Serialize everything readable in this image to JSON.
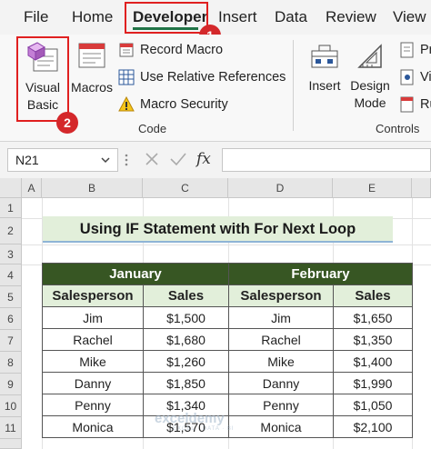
{
  "ribbon_tabs": [
    {
      "label": "File",
      "active": false
    },
    {
      "label": "Home",
      "active": false
    },
    {
      "label": "Developer",
      "active": true
    },
    {
      "label": "Insert",
      "active": false
    },
    {
      "label": "Data",
      "active": false
    },
    {
      "label": "Review",
      "active": false
    },
    {
      "label": "View",
      "active": false
    }
  ],
  "callouts": {
    "first": "1",
    "second": "2"
  },
  "code_group": {
    "visual_basic_line1": "Visual",
    "visual_basic_line2": "Basic",
    "macros": "Macros",
    "record_macro": "Record Macro",
    "use_relative_references": "Use Relative References",
    "macro_security": "Macro Security",
    "label": "Code"
  },
  "controls_group": {
    "insert": "Insert",
    "design_mode_line1": "Design",
    "design_mode_line2": "Mode",
    "properties": "Pr",
    "view_code": "Vi",
    "run_dialog": "Ru",
    "label": "Controls"
  },
  "formula_bar": {
    "name_box": "N21",
    "fx": "fx",
    "formula": ""
  },
  "columns": [
    "A",
    "B",
    "C",
    "D",
    "E"
  ],
  "rows": [
    "1",
    "2",
    "3",
    "4",
    "5",
    "6",
    "7",
    "8",
    "9",
    "10",
    "11"
  ],
  "sheet": {
    "title": "Using IF Statement with For Next Loop",
    "months": [
      "January",
      "February"
    ],
    "headers": [
      "Salesperson",
      "Sales",
      "Salesperson",
      "Sales"
    ],
    "records": [
      [
        "Jim",
        "$1,500",
        "Jim",
        "$1,650"
      ],
      [
        "Rachel",
        "$1,680",
        "Rachel",
        "$1,350"
      ],
      [
        "Mike",
        "$1,260",
        "Mike",
        "$1,400"
      ],
      [
        "Danny",
        "$1,850",
        "Danny",
        "$1,990"
      ],
      [
        "Penny",
        "$1,340",
        "Penny",
        "$1,050"
      ],
      [
        "Monica",
        "$1,570",
        "Monica",
        "$2,100"
      ]
    ]
  },
  "watermark": {
    "brand": "exceldemy",
    "tagline": "EXCEL · DATA · BI"
  },
  "colors": {
    "accent_green": "#217346",
    "header_dark_green": "#375623",
    "header_light_green": "#e2efda",
    "callout_red": "#e02020"
  }
}
